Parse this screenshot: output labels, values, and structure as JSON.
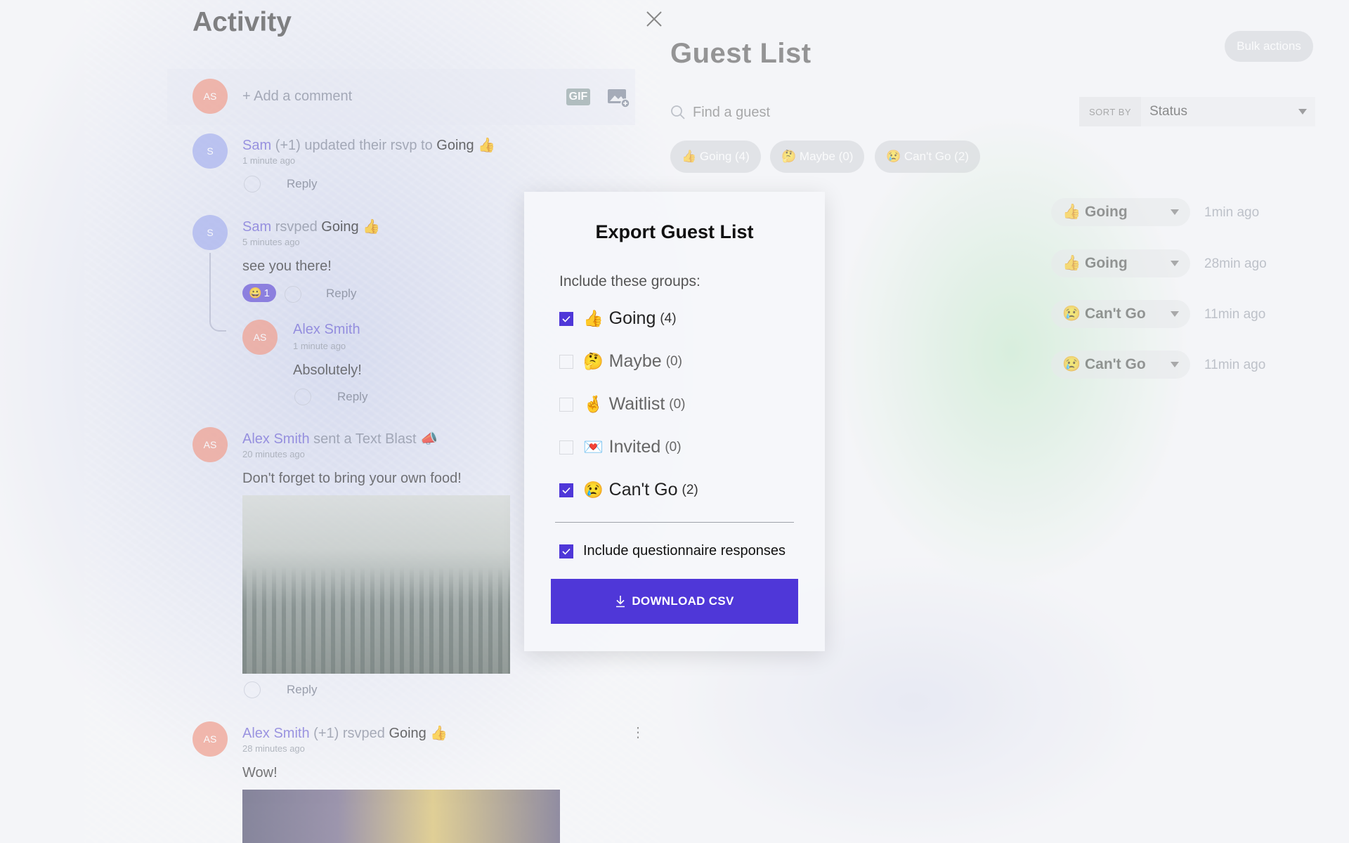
{
  "activity": {
    "title": "Activity",
    "comment": {
      "avatar_initials": "AS",
      "placeholder": "+ Add a comment",
      "gif_label": "GIF"
    },
    "feed": [
      {
        "avatar": "S",
        "name": "Sam",
        "text": "(+1) updated their rsvp to",
        "status": "Going",
        "status_emoji": "👍",
        "time": "1 minute ago",
        "reply": "Reply"
      },
      {
        "avatar": "S",
        "name": "Sam",
        "text": "rsvped",
        "status": "Going",
        "status_emoji": "👍",
        "time": "5 minutes ago",
        "message": "see you there!",
        "reaction_emoji": "😀",
        "reaction_count": "1",
        "reply": "Reply",
        "thread": {
          "avatar": "AS",
          "name": "Alex Smith",
          "time": "1 minute ago",
          "message": "Absolutely!",
          "reply": "Reply"
        }
      },
      {
        "avatar": "AS",
        "name": "Alex Smith",
        "text": "sent a Text Blast",
        "emoji": "📣",
        "time": "20 minutes ago",
        "message": "Don't forget to bring your own food!",
        "reply": "Reply"
      },
      {
        "avatar": "AS",
        "name": "Alex Smith",
        "text": "(+1) rsvped",
        "status": "Going",
        "status_emoji": "👍",
        "time": "28 minutes ago",
        "message": "Wow!"
      }
    ]
  },
  "guest_list": {
    "title": "Guest List",
    "bulk_actions": "Bulk actions",
    "search_placeholder": "Find a guest",
    "sort_by_label": "SORT BY",
    "sort_value": "Status",
    "chips": [
      {
        "emoji": "👍",
        "label": "Going (4)"
      },
      {
        "emoji": "🤔",
        "label": "Maybe (0)"
      },
      {
        "emoji": "😢",
        "label": "Can't Go (2)"
      }
    ],
    "rows": [
      {
        "emoji": "👍",
        "status": "Going",
        "time": "1min ago"
      },
      {
        "emoji": "👍",
        "status": "Going",
        "time": "28min ago"
      },
      {
        "emoji": "😢",
        "status": "Can't Go",
        "time": "11min ago"
      },
      {
        "emoji": "😢",
        "status": "Can't Go",
        "time": "11min ago"
      }
    ]
  },
  "modal": {
    "title": "Export Guest List",
    "include_label": "Include these groups:",
    "groups": [
      {
        "emoji": "👍",
        "label": "Going",
        "count": "(4)",
        "checked": true
      },
      {
        "emoji": "🤔",
        "label": "Maybe",
        "count": "(0)",
        "checked": false
      },
      {
        "emoji": "🤞",
        "label": "Waitlist",
        "count": "(0)",
        "checked": false
      },
      {
        "emoji": "💌",
        "label": "Invited",
        "count": "(0)",
        "checked": false
      },
      {
        "emoji": "😢",
        "label": "Can't Go",
        "count": "(2)",
        "checked": true
      }
    ],
    "questionnaire_label": "Include questionnaire responses",
    "questionnaire_checked": true,
    "download_label": "DOWNLOAD CSV"
  },
  "colors": {
    "accent": "#4f37d8",
    "name_link": "#7a70d8"
  }
}
